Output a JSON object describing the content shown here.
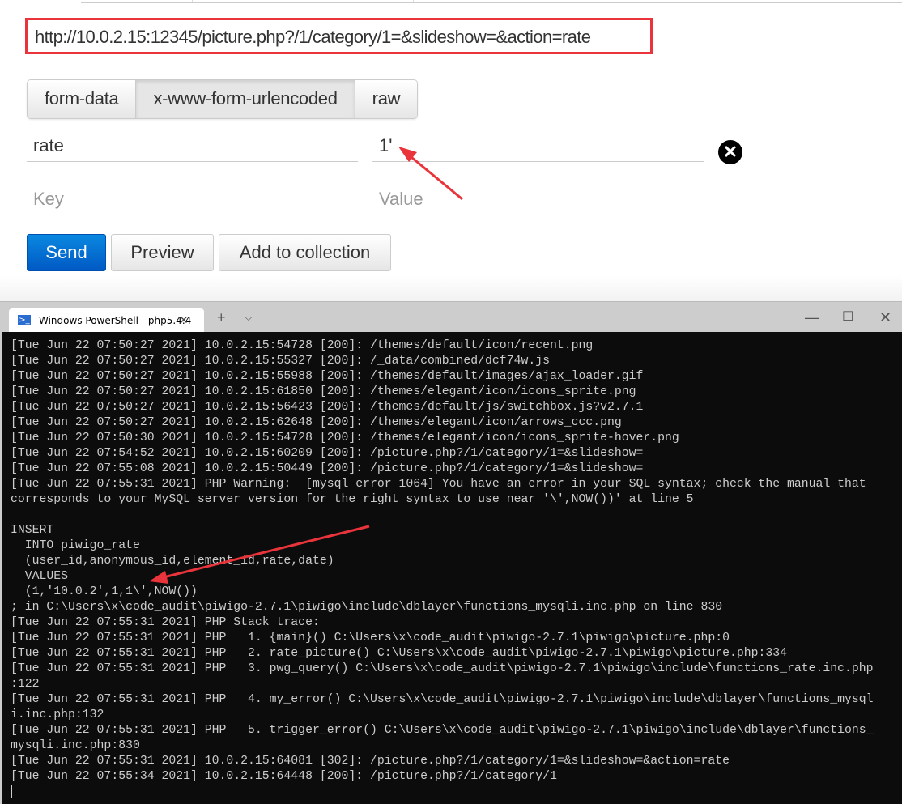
{
  "request": {
    "url": "http://10.0.2.15:12345/picture.php?/1/category/1=&slideshow=&action=rate",
    "body_tabs": [
      {
        "label": "form-data",
        "active": false
      },
      {
        "label": "x-www-form-urlencoded",
        "active": true
      },
      {
        "label": "raw",
        "active": false
      }
    ],
    "params": [
      {
        "key": "rate",
        "value": "1'"
      }
    ],
    "new_param": {
      "key_placeholder": "Key",
      "value_placeholder": "Value"
    },
    "buttons": {
      "send": "Send",
      "preview": "Preview",
      "add_to_collection": "Add to collection"
    }
  },
  "terminal": {
    "tab_title": "Windows PowerShell - php5.4.4",
    "new_tab": "+",
    "lines": [
      "[Tue Jun 22 07:50:27 2021] 10.0.2.15:54728 [200]: /themes/default/icon/recent.png",
      "[Tue Jun 22 07:50:27 2021] 10.0.2.15:55327 [200]: /_data/combined/dcf74w.js",
      "[Tue Jun 22 07:50:27 2021] 10.0.2.15:55988 [200]: /themes/default/images/ajax_loader.gif",
      "[Tue Jun 22 07:50:27 2021] 10.0.2.15:61850 [200]: /themes/elegant/icon/icons_sprite.png",
      "[Tue Jun 22 07:50:27 2021] 10.0.2.15:56423 [200]: /themes/default/js/switchbox.js?v2.7.1",
      "[Tue Jun 22 07:50:27 2021] 10.0.2.15:62648 [200]: /themes/elegant/icon/arrows_ccc.png",
      "[Tue Jun 22 07:50:30 2021] 10.0.2.15:54728 [200]: /themes/elegant/icon/icons_sprite-hover.png",
      "[Tue Jun 22 07:54:52 2021] 10.0.2.15:60209 [200]: /picture.php?/1/category/1=&slideshow=",
      "[Tue Jun 22 07:55:08 2021] 10.0.2.15:50449 [200]: /picture.php?/1/category/1=&slideshow=",
      "[Tue Jun 22 07:55:31 2021] PHP Warning:  [mysql error 1064] You have an error in your SQL syntax; check the manual that",
      "corresponds to your MySQL server version for the right syntax to use near '\\',NOW())' at line 5",
      "",
      "INSERT",
      "  INTO piwigo_rate",
      "  (user_id,anonymous_id,element_id,rate,date)",
      "  VALUES",
      "  (1,'10.0.2',1,1\\',NOW())",
      "; in C:\\Users\\x\\code_audit\\piwigo-2.7.1\\piwigo\\include\\dblayer\\functions_mysqli.inc.php on line 830",
      "[Tue Jun 22 07:55:31 2021] PHP Stack trace:",
      "[Tue Jun 22 07:55:31 2021] PHP   1. {main}() C:\\Users\\x\\code_audit\\piwigo-2.7.1\\piwigo\\picture.php:0",
      "[Tue Jun 22 07:55:31 2021] PHP   2. rate_picture() C:\\Users\\x\\code_audit\\piwigo-2.7.1\\piwigo\\picture.php:334",
      "[Tue Jun 22 07:55:31 2021] PHP   3. pwg_query() C:\\Users\\x\\code_audit\\piwigo-2.7.1\\piwigo\\include\\functions_rate.inc.php",
      ":122",
      "[Tue Jun 22 07:55:31 2021] PHP   4. my_error() C:\\Users\\x\\code_audit\\piwigo-2.7.1\\piwigo\\include\\dblayer\\functions_mysql",
      "i.inc.php:132",
      "[Tue Jun 22 07:55:31 2021] PHP   5. trigger_error() C:\\Users\\x\\code_audit\\piwigo-2.7.1\\piwigo\\include\\dblayer\\functions_",
      "mysqli.inc.php:830",
      "[Tue Jun 22 07:55:31 2021] 10.0.2.15:64081 [302]: /picture.php?/1/category/1=&slideshow=&action=rate",
      "[Tue Jun 22 07:55:34 2021] 10.0.2.15:64448 [200]: /picture.php?/1/category/1"
    ]
  },
  "colors": {
    "highlight": "#e8343a",
    "primary": "#0a6fd6",
    "terminal_bg": "#0c0c0c"
  }
}
